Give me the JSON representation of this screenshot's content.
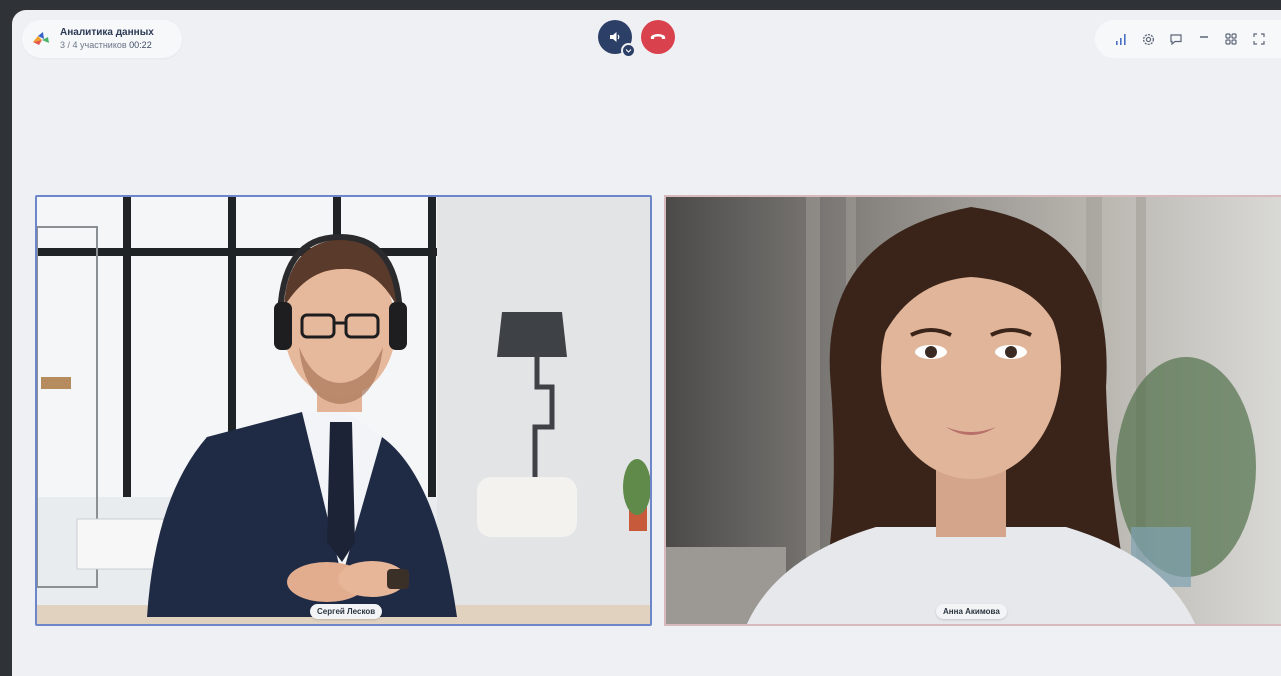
{
  "header": {
    "title": "Аналитика данных",
    "participants": "3 / 4 участников",
    "elapsed": "00:22"
  },
  "controls": {
    "speaker_icon": "speaker-icon",
    "hangup_icon": "phone-hangup-icon"
  },
  "toolbar": {
    "icons": [
      "signal-bars-icon",
      "settings-gear-icon",
      "chat-icon",
      "minimize-icon",
      "grid-layout-icon",
      "fullscreen-icon"
    ]
  },
  "participants": [
    {
      "name": "Сергей Лесков",
      "active_speaker": true
    },
    {
      "name": "Анна Акимова",
      "active_speaker": false
    }
  ],
  "colors": {
    "accent": "#2c3f66",
    "hangup": "#d9414d",
    "active_border": "#6d86c9"
  }
}
